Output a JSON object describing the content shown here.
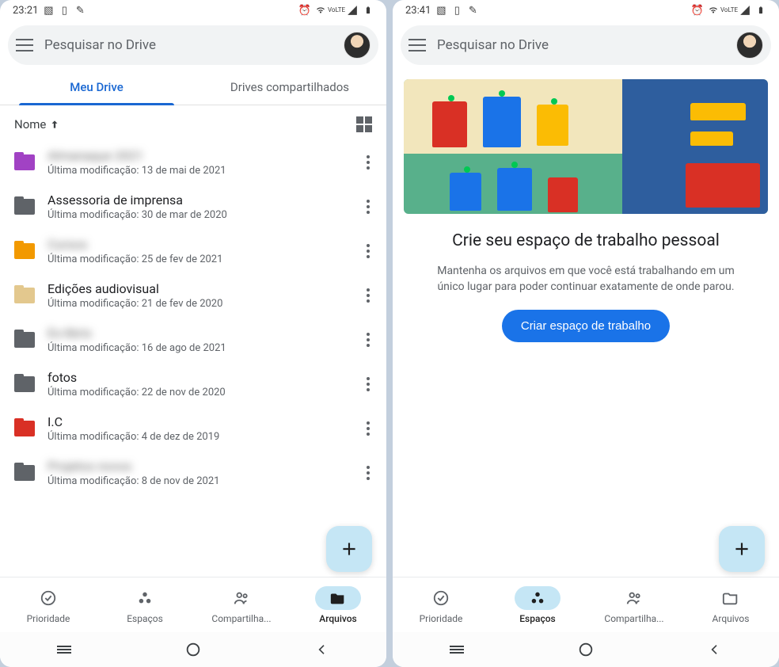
{
  "left": {
    "status": {
      "time": "23:21"
    },
    "search": {
      "placeholder": "Pesquisar no Drive"
    },
    "tabs": {
      "my_drive": "Meu Drive",
      "shared": "Drives compartilhados",
      "active": 0
    },
    "sort": {
      "label": "Nome"
    },
    "files": [
      {
        "name": "Almanaque 2021",
        "mod": "Última modificação: 13 de mai de 2021",
        "blurred": true,
        "color": "purple"
      },
      {
        "name": "Assessoria de imprensa",
        "mod": "Última modificação: 30 de mar de 2020",
        "blurred": false,
        "color": "black"
      },
      {
        "name": "Cursos",
        "mod": "Última modificação: 25 de fev de 2021",
        "blurred": true,
        "color": "orange"
      },
      {
        "name": "Edições audiovisual",
        "mod": "Última modificação: 21 de fev de 2020",
        "blurred": false,
        "color": "beige"
      },
      {
        "name": "Ex-libris",
        "mod": "Última modificação: 16 de ago de 2021",
        "blurred": true,
        "color": "black"
      },
      {
        "name": "fotos",
        "mod": "Última modificação: 22 de nov de 2020",
        "blurred": false,
        "color": "black"
      },
      {
        "name": "I.C",
        "mod": "Última modificação: 4 de dez de 2019",
        "blurred": false,
        "color": "red"
      },
      {
        "name": "Projetos novos",
        "mod": "Última modificação: 8 de nov de 2021",
        "blurred": true,
        "color": "black"
      }
    ],
    "nav": {
      "priority": "Prioridade",
      "spaces": "Espaços",
      "shared": "Compartilha...",
      "files": "Arquivos",
      "active": 3
    }
  },
  "right": {
    "status": {
      "time": "23:41"
    },
    "search": {
      "placeholder": "Pesquisar no Drive"
    },
    "promo": {
      "title": "Crie seu espaço de trabalho pessoal",
      "desc": "Mantenha os arquivos em que você está trabalhando em um único lugar para poder continuar exatamente de onde parou.",
      "button": "Criar espaço de trabalho"
    },
    "nav": {
      "priority": "Prioridade",
      "spaces": "Espaços",
      "shared": "Compartilha...",
      "files": "Arquivos",
      "active": 1
    }
  }
}
